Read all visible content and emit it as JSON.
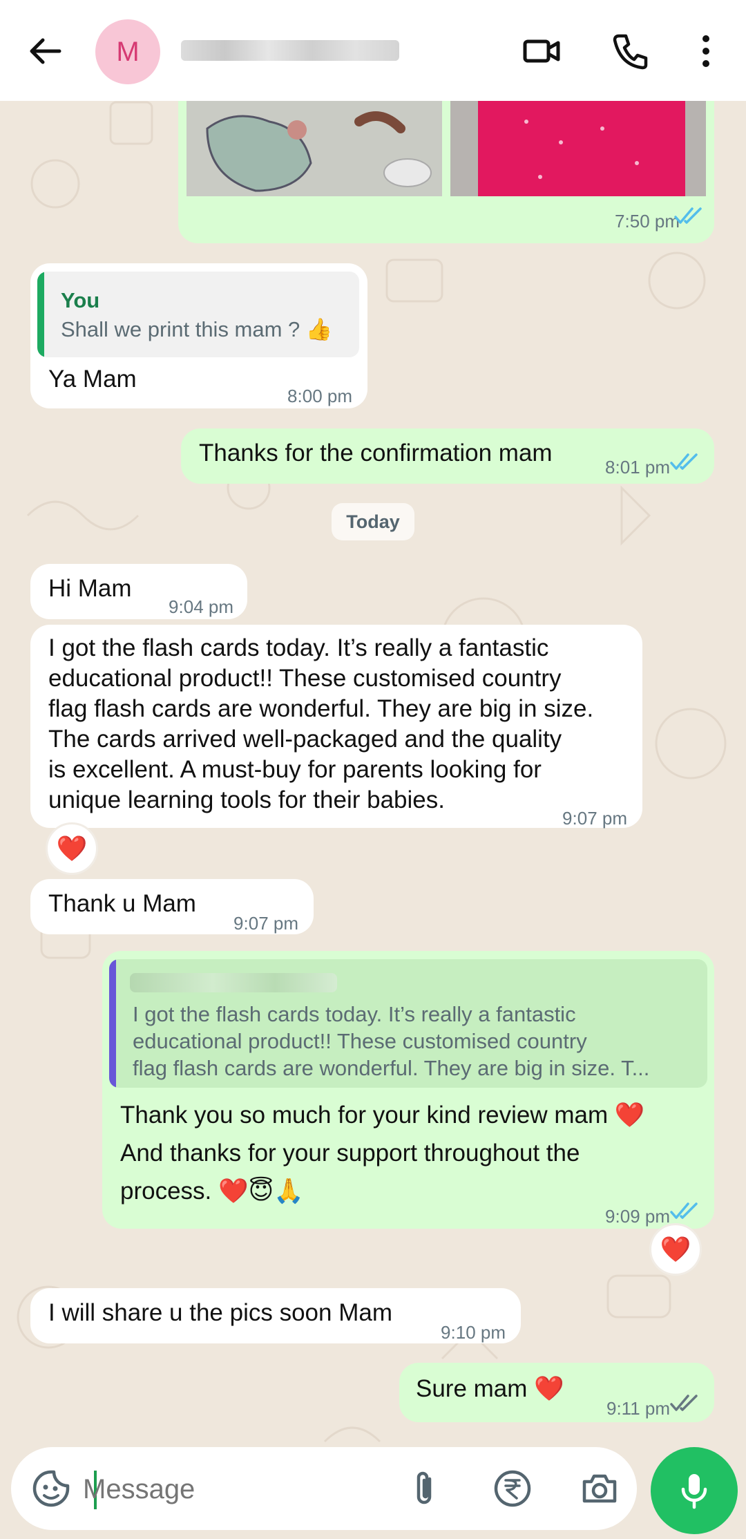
{
  "header": {
    "avatar_letter": "M",
    "contact_name": "",
    "icons": [
      "back-arrow-icon",
      "video-call-icon",
      "voice-call-icon",
      "more-options-icon"
    ]
  },
  "messages": {
    "m1": {
      "time": "7:50 pm",
      "status": "read"
    },
    "m2": {
      "quote_author": "You",
      "quote_text": "Shall we print this mam ? 👍",
      "text": "Ya Mam",
      "time": "8:00 pm"
    },
    "m3": {
      "text": "Thanks for the confirmation mam",
      "time": "8:01 pm",
      "status": "read"
    },
    "date_separator": "Today",
    "m4": {
      "text": "Hi Mam",
      "time": "9:04 pm"
    },
    "m5": {
      "text": "I got the flash cards today. It’s really a fantastic\neducational product!! These customised country\nflag flash cards are wonderful. They are big in size.\nThe cards arrived well-packaged and the quality\nis excellent. A must-buy for parents looking for\nunique learning tools for their babies.",
      "time": "9:07 pm",
      "reaction": "❤️"
    },
    "m6": {
      "text": "Thank u Mam",
      "time": "9:07 pm"
    },
    "m7": {
      "quote_text": "I got the flash cards today. It’s really a fantastic\neducational product!! These customised country\nflag flash cards are wonderful. They are big in size.  T...",
      "text": "Thank you so much for your kind review mam ❤️\nAnd thanks for your support throughout the\nprocess. ❤️😇🙏",
      "time": "9:09 pm",
      "status": "read",
      "reaction": "❤️"
    },
    "m8": {
      "text": "I will share u the pics soon Mam",
      "time": "9:10 pm"
    },
    "m9": {
      "text": "Sure mam ❤️",
      "time": "9:11 pm",
      "status": "delivered"
    }
  },
  "composer": {
    "placeholder": "Message",
    "icons": [
      "sticker-icon",
      "attach-icon",
      "rupee-payment-icon",
      "camera-icon",
      "mic-icon"
    ]
  },
  "colors": {
    "incoming": "#ffffff",
    "outgoing": "#d9fdd3",
    "read_ticks": "#53bdeb",
    "accent_green": "#21c063",
    "chat_background": "#efe7dc"
  }
}
